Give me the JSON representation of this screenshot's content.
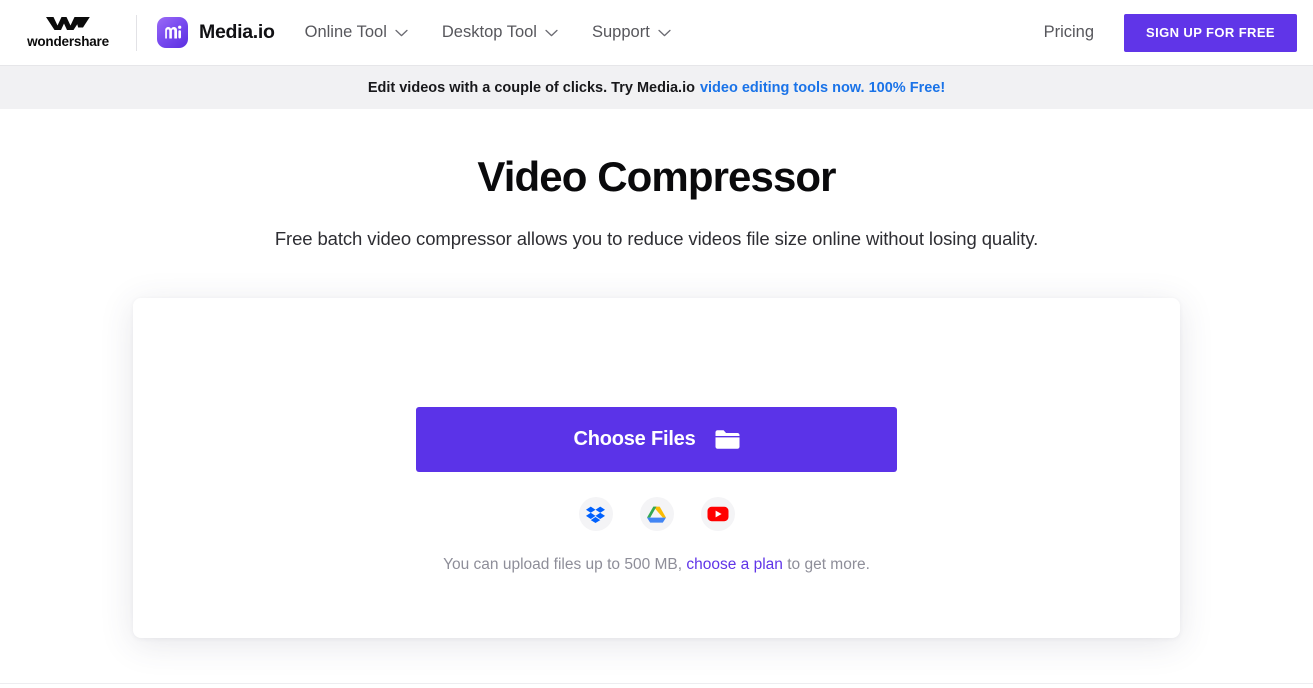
{
  "header": {
    "wondershare_brand": "wondershare",
    "wondershare_logo_icon": "wondershare-w-mark",
    "media_logo_icon": "media-io-logo-icon",
    "media_brand": "Media.io",
    "nav_items": [
      {
        "label": "Online Tool",
        "icon": "chevron-down-icon"
      },
      {
        "label": "Desktop Tool",
        "icon": "chevron-down-icon"
      },
      {
        "label": "Support",
        "icon": "chevron-down-icon"
      }
    ],
    "pricing_label": "Pricing",
    "signup_label": "SIGN UP FOR FREE",
    "signup_color": "#6035e8"
  },
  "banner": {
    "text": "Edit videos with a couple of clicks. Try Media.io",
    "link_text": "video editing tools now. 100% Free!",
    "link_color": "#1a73e8",
    "background": "#f1f1f3"
  },
  "main": {
    "title": "Video Compressor",
    "subtitle": "Free batch video compressor allows you to reduce videos file size online without losing quality."
  },
  "upload": {
    "choose_files_label": "Choose Files",
    "folder_icon": "folder-icon",
    "button_color": "#5b33e8",
    "cloud_sources": [
      {
        "name": "dropbox-icon",
        "label": "Dropbox",
        "color": "#0061fe"
      },
      {
        "name": "google-drive-icon",
        "label": "Google Drive",
        "color": "#fbbc04"
      },
      {
        "name": "youtube-icon",
        "label": "YouTube",
        "color": "#ff0000"
      }
    ],
    "limit_prefix": "You can upload files up to 500 MB,",
    "limit_link": "choose a plan",
    "limit_suffix": "to get more.",
    "limit_link_color": "#6035e8"
  }
}
